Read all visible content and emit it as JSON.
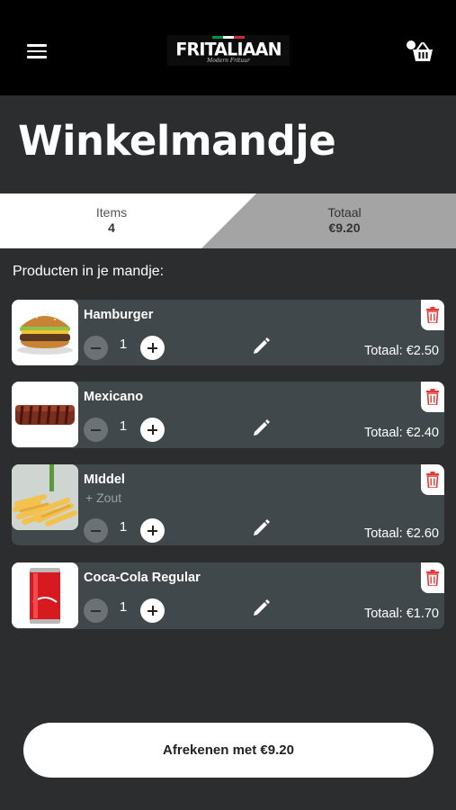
{
  "header": {
    "logo_text": "FRITALIAAN",
    "logo_subtitle": "Modern Frituur",
    "icons": [
      "menu-icon",
      "cart-icon"
    ]
  },
  "page_title": "Winkelmandje",
  "summary": {
    "items_label": "Items",
    "items_value": "4",
    "total_label": "Totaal",
    "total_value": "€9.20"
  },
  "section_label": "Producten in je mandje:",
  "products": [
    {
      "name": "Hamburger",
      "option": "",
      "quantity": "1",
      "total": "Totaal: €2.50",
      "image_icon": "hamburger-image"
    },
    {
      "name": "Mexicano",
      "option": "",
      "quantity": "1",
      "total": "Totaal: €2.40",
      "image_icon": "mexicano-image"
    },
    {
      "name": "MIddel",
      "option": "+ Zout",
      "quantity": "1",
      "total": "Totaal: €2.60",
      "image_icon": "fries-image"
    },
    {
      "name": "Coca-Cola Regular",
      "option": "",
      "quantity": "1",
      "total": "Totaal: €1.70",
      "image_icon": "coca-cola-can-image"
    }
  ],
  "checkout": {
    "label": "Afrekenen met €9.20"
  },
  "colors": {
    "background": "#2b2d2f",
    "topbar": "#000000",
    "card": "#41484c",
    "delete_red": "#e53935",
    "flag_green": "#009246",
    "flag_white": "#ffffff",
    "flag_red": "#ce2b37"
  }
}
